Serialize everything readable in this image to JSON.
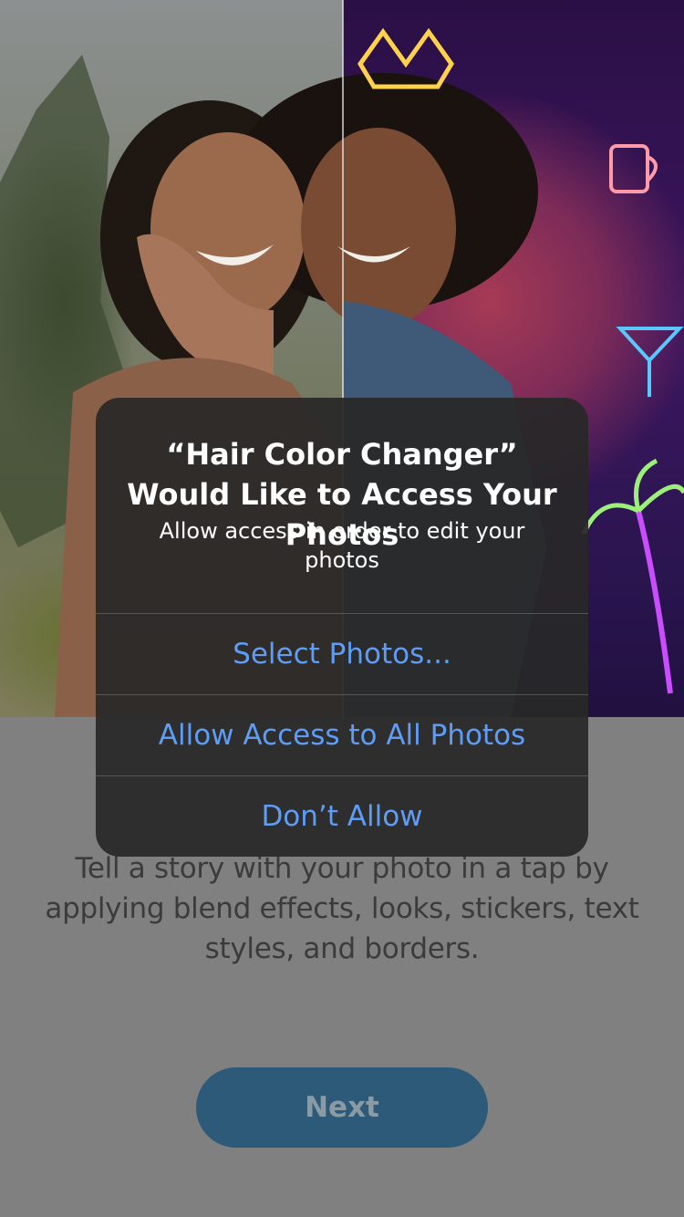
{
  "onboarding": {
    "description": "Tell a story with your photo in a tap by applying blend effects, looks, stickers, text styles, and borders.",
    "next_label": "Next"
  },
  "alert": {
    "title": "“Hair Color Changer” Would Like to Access Your Photos",
    "message": "Allow access in order to edit your photos",
    "actions": [
      {
        "label": "Select Photos..."
      },
      {
        "label": "Allow Access to All Photos"
      },
      {
        "label": "Don’t Allow"
      }
    ]
  },
  "colors": {
    "dim_overlay": "#808080",
    "alert_bg": "#282828",
    "action_blue": "#5f9df5",
    "next_button": "#2c5a78"
  }
}
